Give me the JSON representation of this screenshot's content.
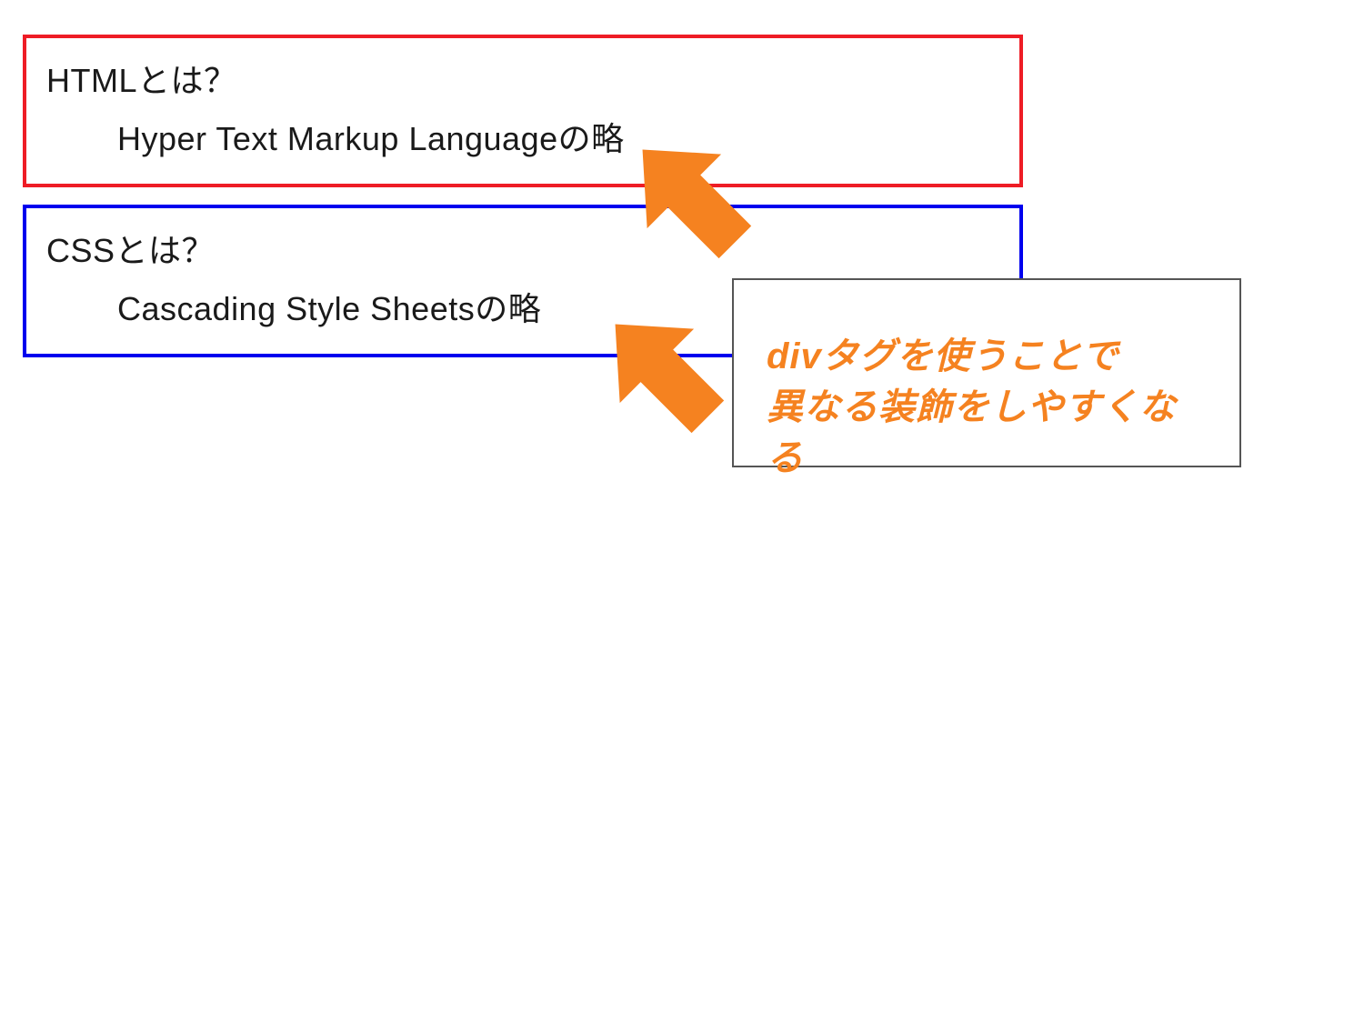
{
  "boxes": {
    "red": {
      "title": "HTMLとは？",
      "desc": "Hyper Text Markup Languageの略"
    },
    "blue": {
      "title": "CSSとは？",
      "desc": "Cascading Style Sheetsの略"
    }
  },
  "callout": {
    "line1": "divタグを使うことで",
    "line2": "異なる装飾をしやすくなる"
  },
  "colors": {
    "red_border": "#ee1c25",
    "blue_border": "#0000ee",
    "arrow": "#f58220",
    "callout_text": "#f58220",
    "callout_border": "#555555"
  }
}
